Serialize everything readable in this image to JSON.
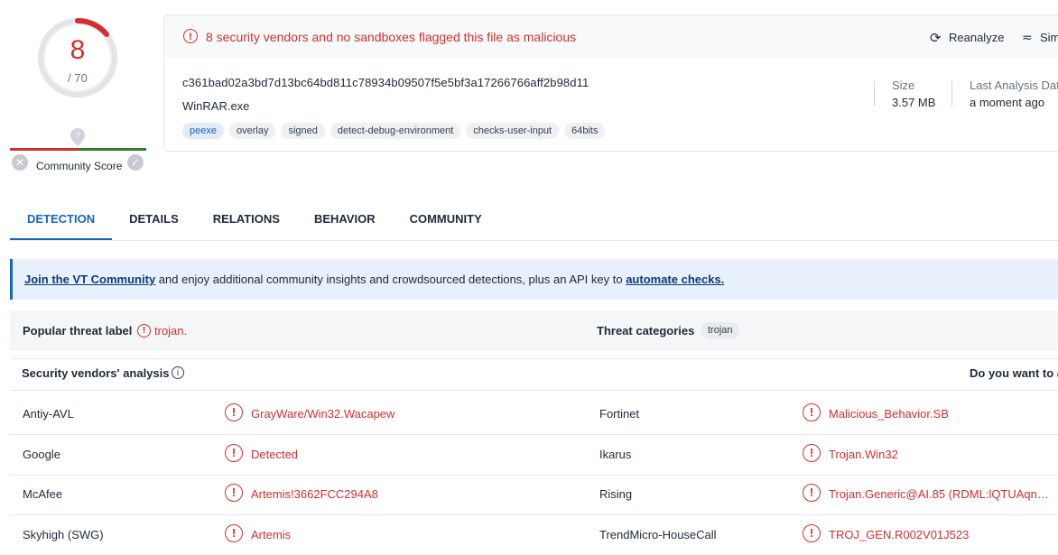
{
  "score": {
    "detections": "8",
    "total": "/ 70"
  },
  "community": {
    "label": "Community Score"
  },
  "summary": {
    "alert": "8 security vendors and no sandboxes flagged this file as malicious",
    "reanalyze_label": "Reanalyze",
    "similar_label": "Sim",
    "hash": "c361bad02a3bd7d13bc64bd811c78934b09507f5e5bf3a17266766aff2b98d11",
    "filename": "WinRAR.exe",
    "tags": [
      "peexe",
      "overlay",
      "signed",
      "detect-debug-environment",
      "checks-user-input",
      "64bits"
    ],
    "size_label": "Size",
    "size_value": "3.57 MB",
    "last_analysis_label": "Last Analysis Dat",
    "last_analysis_value": "a moment ago"
  },
  "tabs": [
    "DETECTION",
    "DETAILS",
    "RELATIONS",
    "BEHAVIOR",
    "COMMUNITY"
  ],
  "banner": {
    "link1": "Join the VT Community",
    "middle": " and enjoy additional community insights and crowdsourced detections, plus an API key to ",
    "link2": "automate checks."
  },
  "threat": {
    "popular_label": "Popular threat label",
    "popular_value": "trojan.",
    "categories_label": "Threat categories",
    "categories_value": "trojan"
  },
  "vendors_section": {
    "title": "Security vendors' analysis",
    "right_text": "Do you want to a"
  },
  "vendors": [
    {
      "left_name": "Antiy-AVL",
      "left_result": "GrayWare/Win32.Wacapew",
      "right_name": "Fortinet",
      "right_result": "Malicious_Behavior.SB"
    },
    {
      "left_name": "Google",
      "left_result": "Detected",
      "right_name": "Ikarus",
      "right_result": "Trojan.Win32"
    },
    {
      "left_name": "McAfee",
      "left_result": "Artemis!3662FCC294A8",
      "right_name": "Rising",
      "right_result": "Trojan.Generic@AI.85 (RDML:lQTUAqnO..."
    },
    {
      "left_name": "Skyhigh (SWG)",
      "left_result": "Artemis",
      "right_name": "TrendMicro-HouseCall",
      "right_result": "TROJ_GEN.R002V01J523"
    }
  ],
  "colors": {
    "malicious": "#d32f2f",
    "accent": "#1565c0"
  }
}
